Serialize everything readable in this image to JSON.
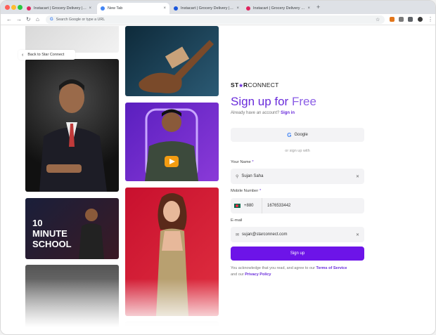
{
  "browser": {
    "tabs": [
      {
        "title": "Instacart | Grocery Delivery | Order...",
        "active": false,
        "favicon_color": "#e0245e"
      },
      {
        "title": "New Tab",
        "active": true,
        "favicon_color": "#4285f4"
      },
      {
        "title": "Instacart | Grocery Delivery | Order...",
        "active": false,
        "favicon_color": "#1a56db"
      },
      {
        "title": "Instacart | Grocery Delivery | Order...",
        "active": false,
        "favicon_color": "#e0245e"
      }
    ],
    "new_tab": "+",
    "close": "×",
    "address_placeholder": "Search Google or type a URL",
    "nav": {
      "back": "←",
      "forward": "→",
      "reload": "↻",
      "home": "⌂"
    }
  },
  "left": {
    "back_label": "Back to Star Connect",
    "back_icon": "arrow-left-icon",
    "photo_caption": "10 MINUTE SCHOOL"
  },
  "form": {
    "logo_prefix": "ST",
    "logo_star": "★",
    "logo_suffix": "R",
    "logo_rest": "CONNECT",
    "heading_main": "Sign up for ",
    "heading_free": "Free",
    "already_text": "Already have an account?",
    "signin_link": "Sign in",
    "google_label": "Google",
    "or_text": "or sign up with",
    "name": {
      "label": "Your Name",
      "required_mark": "*",
      "value": "Sujan Saha"
    },
    "mobile": {
      "label": "Mobile Number",
      "required_mark": "*",
      "country_code": "+880",
      "value": "1676533442"
    },
    "email": {
      "label": "E-mail",
      "value": "sujan@starconnect.com"
    },
    "submit_label": "Sign up",
    "legal_text": "You acknowledge that you read, and agree to our",
    "terms_link": "Terms of Service",
    "and_text": "and our",
    "privacy_link": "Privacy Policy"
  },
  "colors": {
    "accent": "#6d14e8",
    "heading": "#6a2cdb",
    "field_bg": "#f3f3f5"
  }
}
